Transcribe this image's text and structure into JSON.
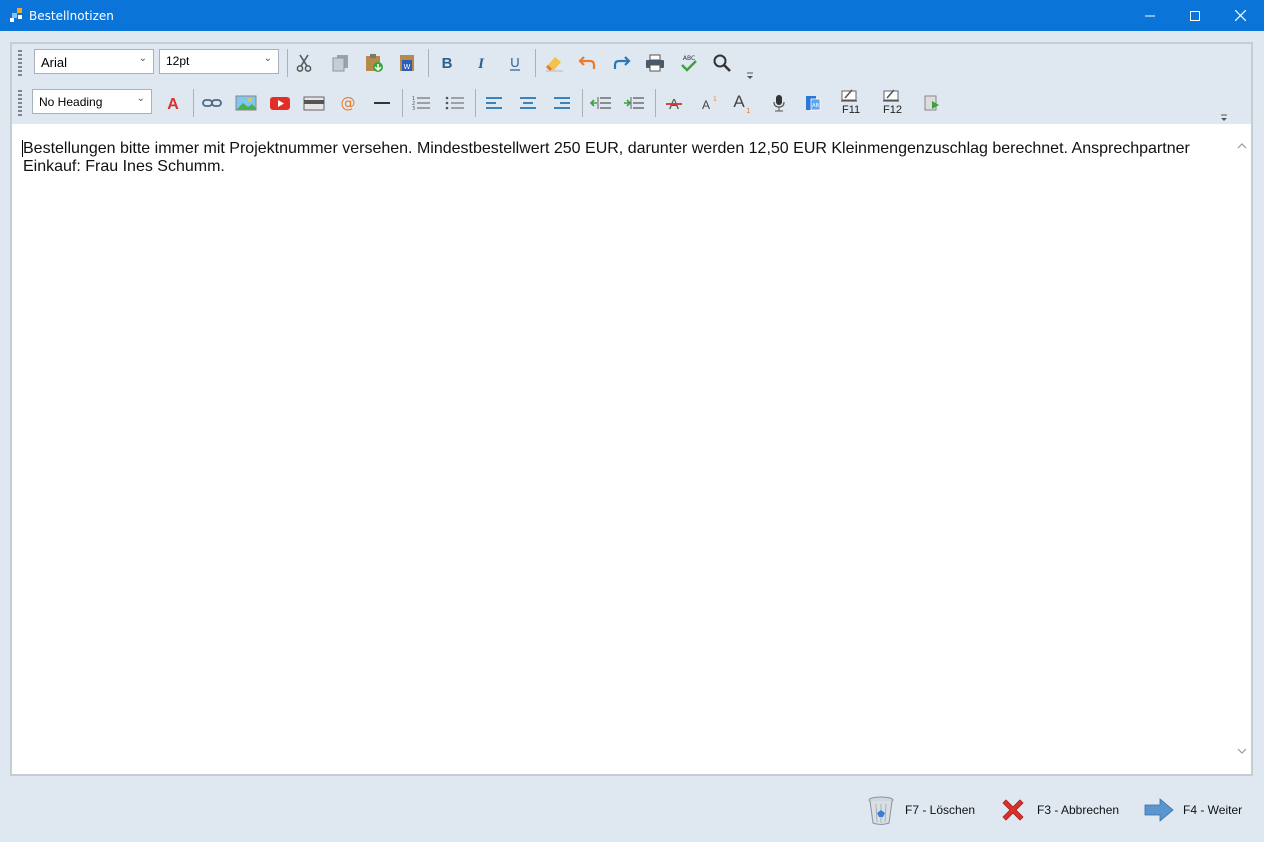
{
  "window": {
    "title": "Bestellnotizen",
    "icon": "app-logo-icon",
    "controls": [
      "minimize-icon",
      "maximize-icon",
      "close-icon"
    ]
  },
  "toolbar": {
    "font_family": "Arial",
    "font_size": "12pt",
    "heading": "No Heading",
    "f11_label": "F11",
    "f12_label": "F12",
    "row1_icons": [
      "cut-icon",
      "copy-icon",
      "paste-icon",
      "paste-word-icon",
      "bold-icon",
      "italic-icon",
      "underline-icon",
      "clear-format-icon",
      "undo-icon",
      "redo-icon",
      "print-icon",
      "spellcheck-icon",
      "search-icon"
    ],
    "row2_icons": [
      "font-color-icon",
      "link-icon",
      "image-icon",
      "video-icon",
      "table-icon",
      "email-icon",
      "horizontal-rule-icon",
      "ordered-list-icon",
      "bullet-list-icon",
      "align-left-icon",
      "align-center-icon",
      "align-right-icon",
      "outdent-icon",
      "indent-icon",
      "strikethrough-icon",
      "superscript-icon",
      "subscript-icon",
      "microphone-icon",
      "insert-field-icon",
      "f11-icon",
      "f12-icon",
      "preview-icon"
    ]
  },
  "editor": {
    "content": "Bestellungen bitte immer mit Projektnummer versehen. Mindestbestellwert 250 EUR, darunter werden 12,50 EUR Kleinmengenzuschlag berechnet. Ansprechpartner Einkauf: Frau Ines Schumm."
  },
  "actions": {
    "delete": {
      "label": "F7 - Löschen",
      "icon": "trash-icon"
    },
    "cancel": {
      "label": "F3 - Abbrechen",
      "icon": "red-x-icon"
    },
    "next": {
      "label": "F4 - Weiter",
      "icon": "arrow-right-icon"
    }
  },
  "colors": {
    "titlebar": "#0a74d8",
    "background": "#dfe7f1",
    "icon_blue": "#2a78b7",
    "accent_red": "#d9322b",
    "accent_orange": "#e97b2a",
    "accent_green": "#3aa33a"
  }
}
